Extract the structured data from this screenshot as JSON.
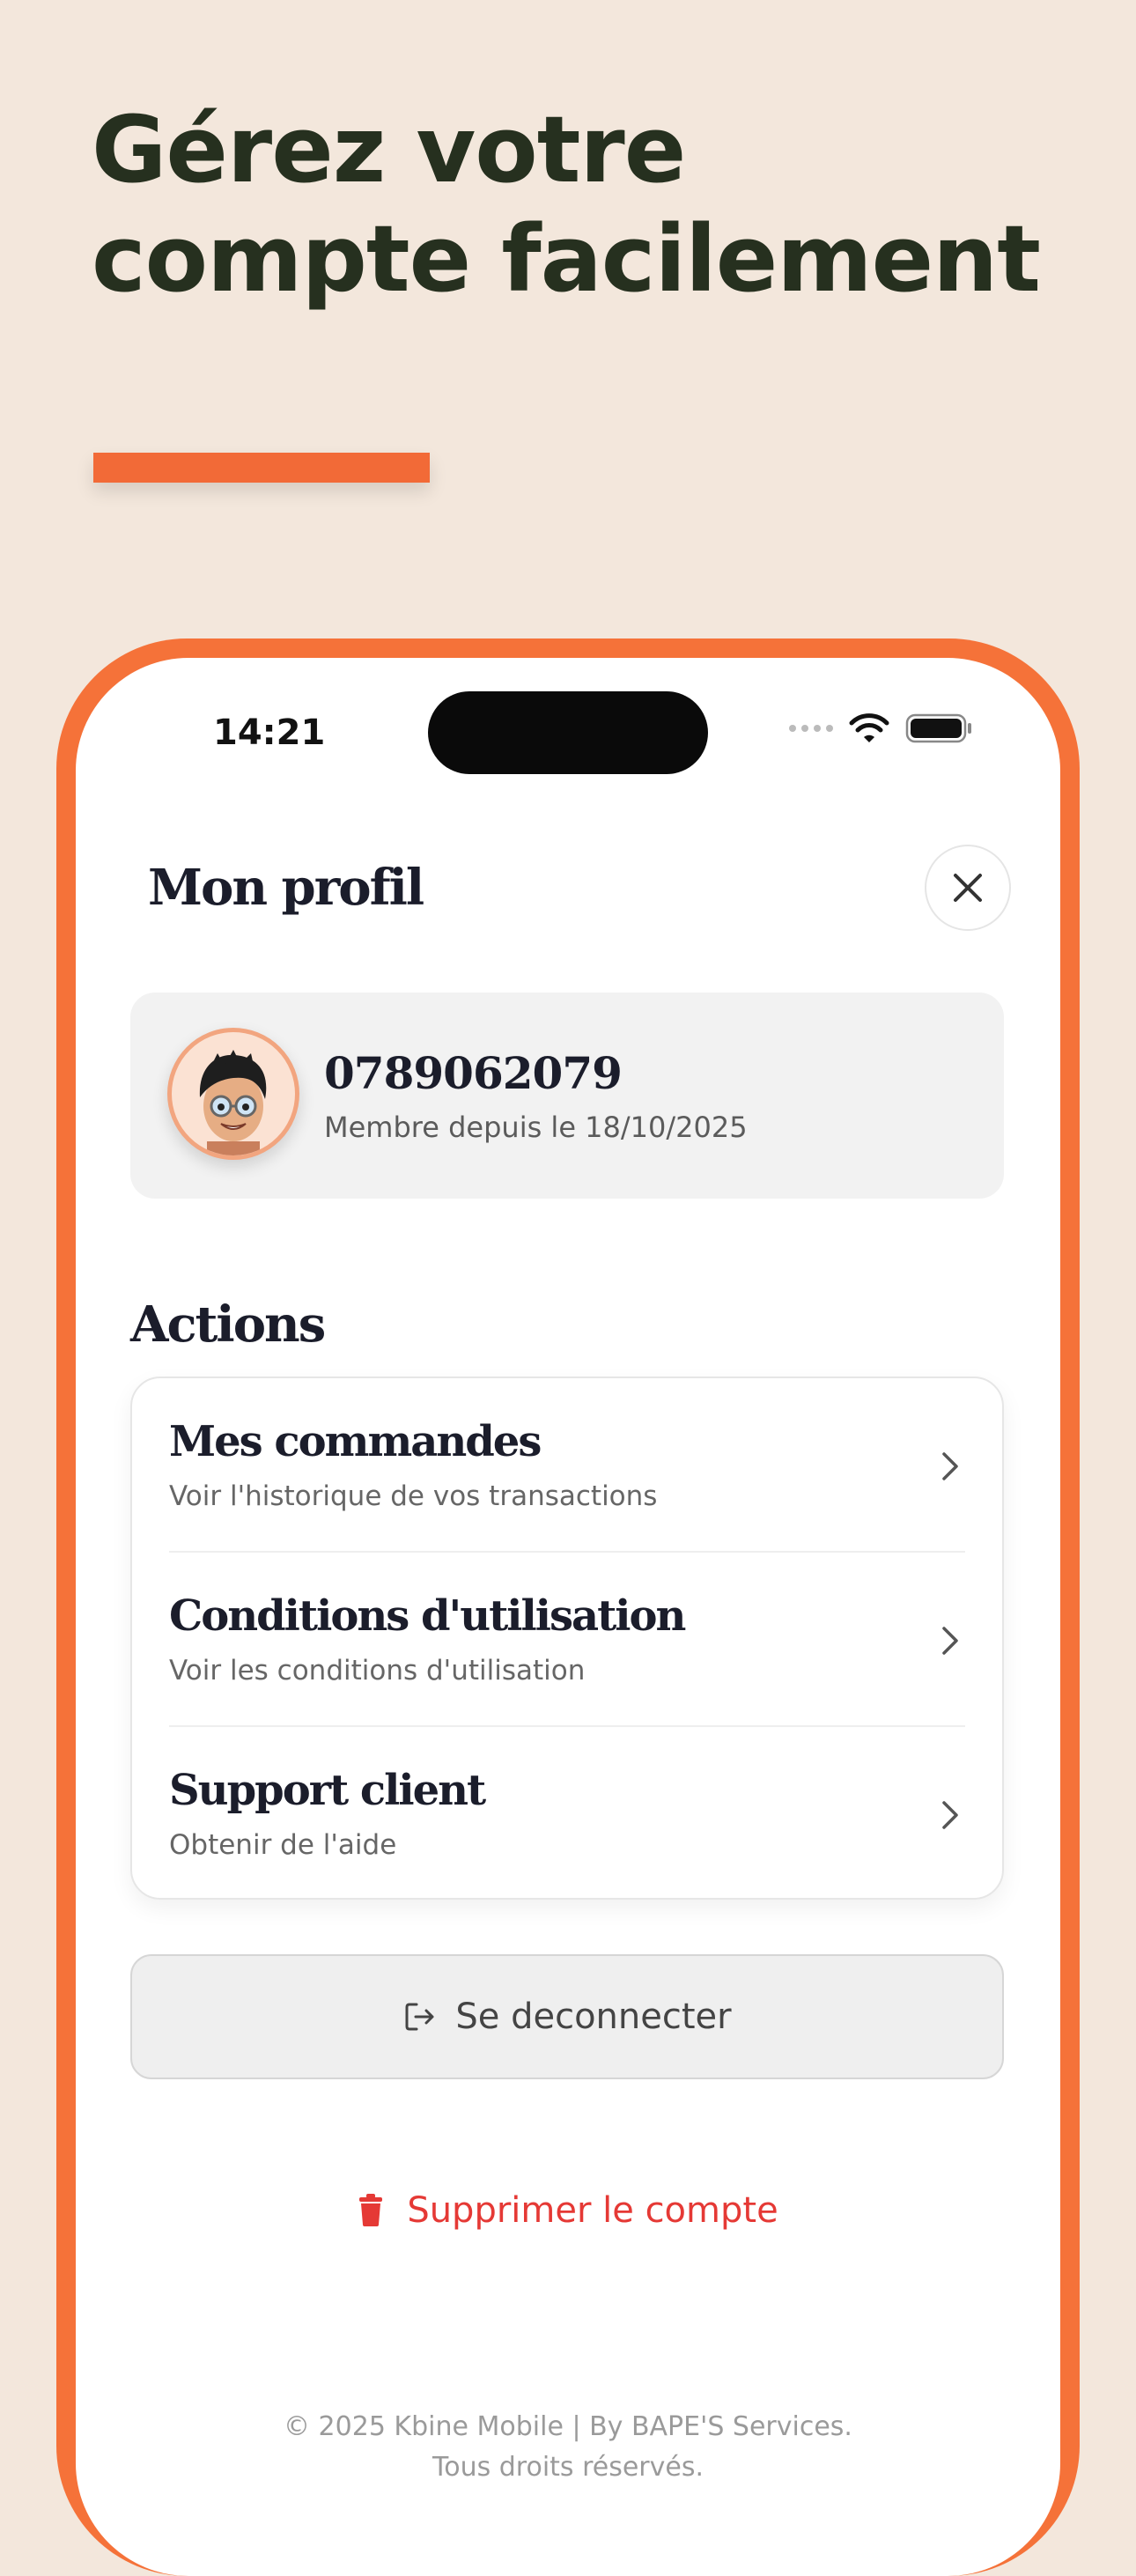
{
  "headline": {
    "line1": "Gérez votre",
    "line2": "compte facilement"
  },
  "colors": {
    "background": "#f3e7dc",
    "accent": "#f26a37",
    "headline": "#26301f",
    "danger": "#e53935"
  },
  "status_bar": {
    "time": "14:21",
    "icons": [
      "signal-dots-icon",
      "wifi-icon",
      "battery-icon"
    ]
  },
  "header": {
    "title": "Mon profil",
    "close_icon": "close-icon"
  },
  "profile": {
    "phone": "0789062079",
    "member_since": "Membre depuis le 18/10/2025",
    "avatar": "memoji-avatar"
  },
  "actions": {
    "title": "Actions",
    "items": [
      {
        "title": "Mes commandes",
        "subtitle": "Voir l'historique de vos transactions",
        "icon": "chevron-right-icon"
      },
      {
        "title": "Conditions d'utilisation",
        "subtitle": "Voir les conditions d'utilisation",
        "icon": "chevron-right-icon"
      },
      {
        "title": "Support client",
        "subtitle": "Obtenir de l'aide",
        "icon": "chevron-right-icon"
      }
    ]
  },
  "logout": {
    "label": "Se deconnecter",
    "icon": "logout-icon"
  },
  "delete_account": {
    "label": "Supprimer le compte",
    "icon": "trash-icon"
  },
  "footer": {
    "line1": "© 2025 Kbine Mobile | By BAPE'S Services.",
    "line2": "Tous droits réservés."
  }
}
